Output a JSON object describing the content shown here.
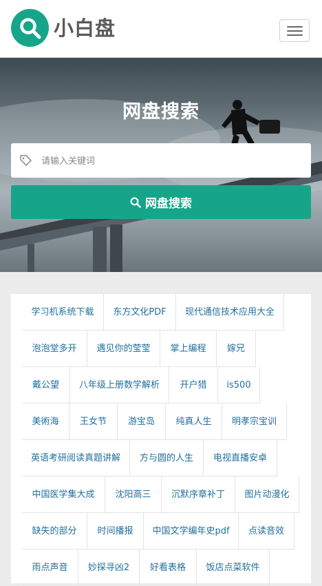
{
  "header": {
    "logo_text": "小白盘",
    "brand_color": "#17a589"
  },
  "hero": {
    "title": "网盘搜索",
    "search_placeholder": "请输入关键词",
    "search_button_label": "网盘搜索"
  },
  "tags": [
    "学习机系统下载",
    "东方文化PDF",
    "现代通信技术应用大全",
    "泡泡堂多开",
    "遇见你的莹莹",
    "掌上编程",
    "嫁兄",
    "戴公望",
    "八年级上册数学解析",
    "开户猎",
    "is500",
    "美術海",
    "王女节",
    "游宝岛",
    "纯真人生",
    "明孝宗宝训",
    "英语考研阅读真题讲解",
    "方与圆的人生",
    "电视直播安卓",
    "中国医学集大成",
    "沈阳高三",
    "沉默序章补丁",
    "图片动漫化",
    "缺失的部分",
    "时间播报",
    "中国文学编年史pdf",
    "点读音效",
    "雨点声音",
    "妙探寻凶2",
    "好看表格",
    "饭店点菜软件"
  ]
}
